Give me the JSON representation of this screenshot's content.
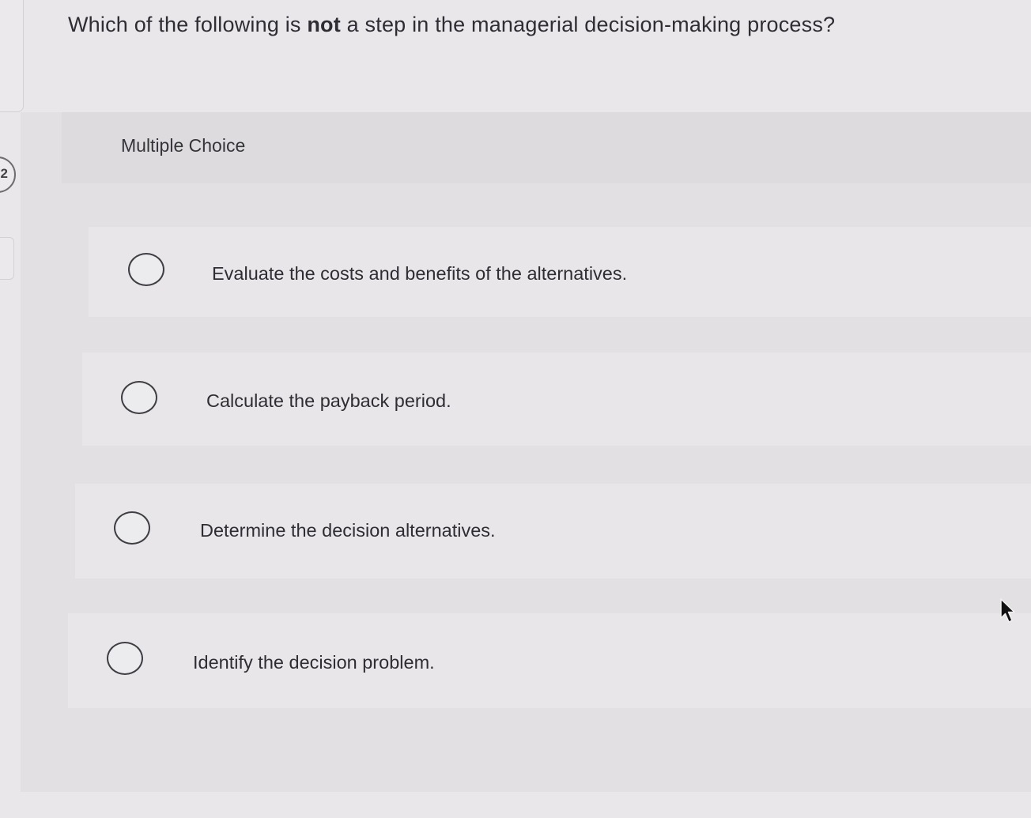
{
  "sidebar": {
    "question_number": "2"
  },
  "question": {
    "prefix": "Which of the following is ",
    "emphasis": "not",
    "suffix": " a step in the managerial decision-making process?"
  },
  "answer_panel": {
    "type_label": "Multiple Choice",
    "choices": [
      {
        "text": "Evaluate the costs and benefits of the alternatives.",
        "selected": false
      },
      {
        "text": "Calculate the payback period.",
        "selected": false
      },
      {
        "text": "Determine the decision alternatives.",
        "selected": false
      },
      {
        "text": "Identify the decision problem.",
        "selected": false
      }
    ]
  },
  "icons": {
    "radio": "radio-unchecked-icon",
    "pointer": "mouse-pointer-icon"
  }
}
